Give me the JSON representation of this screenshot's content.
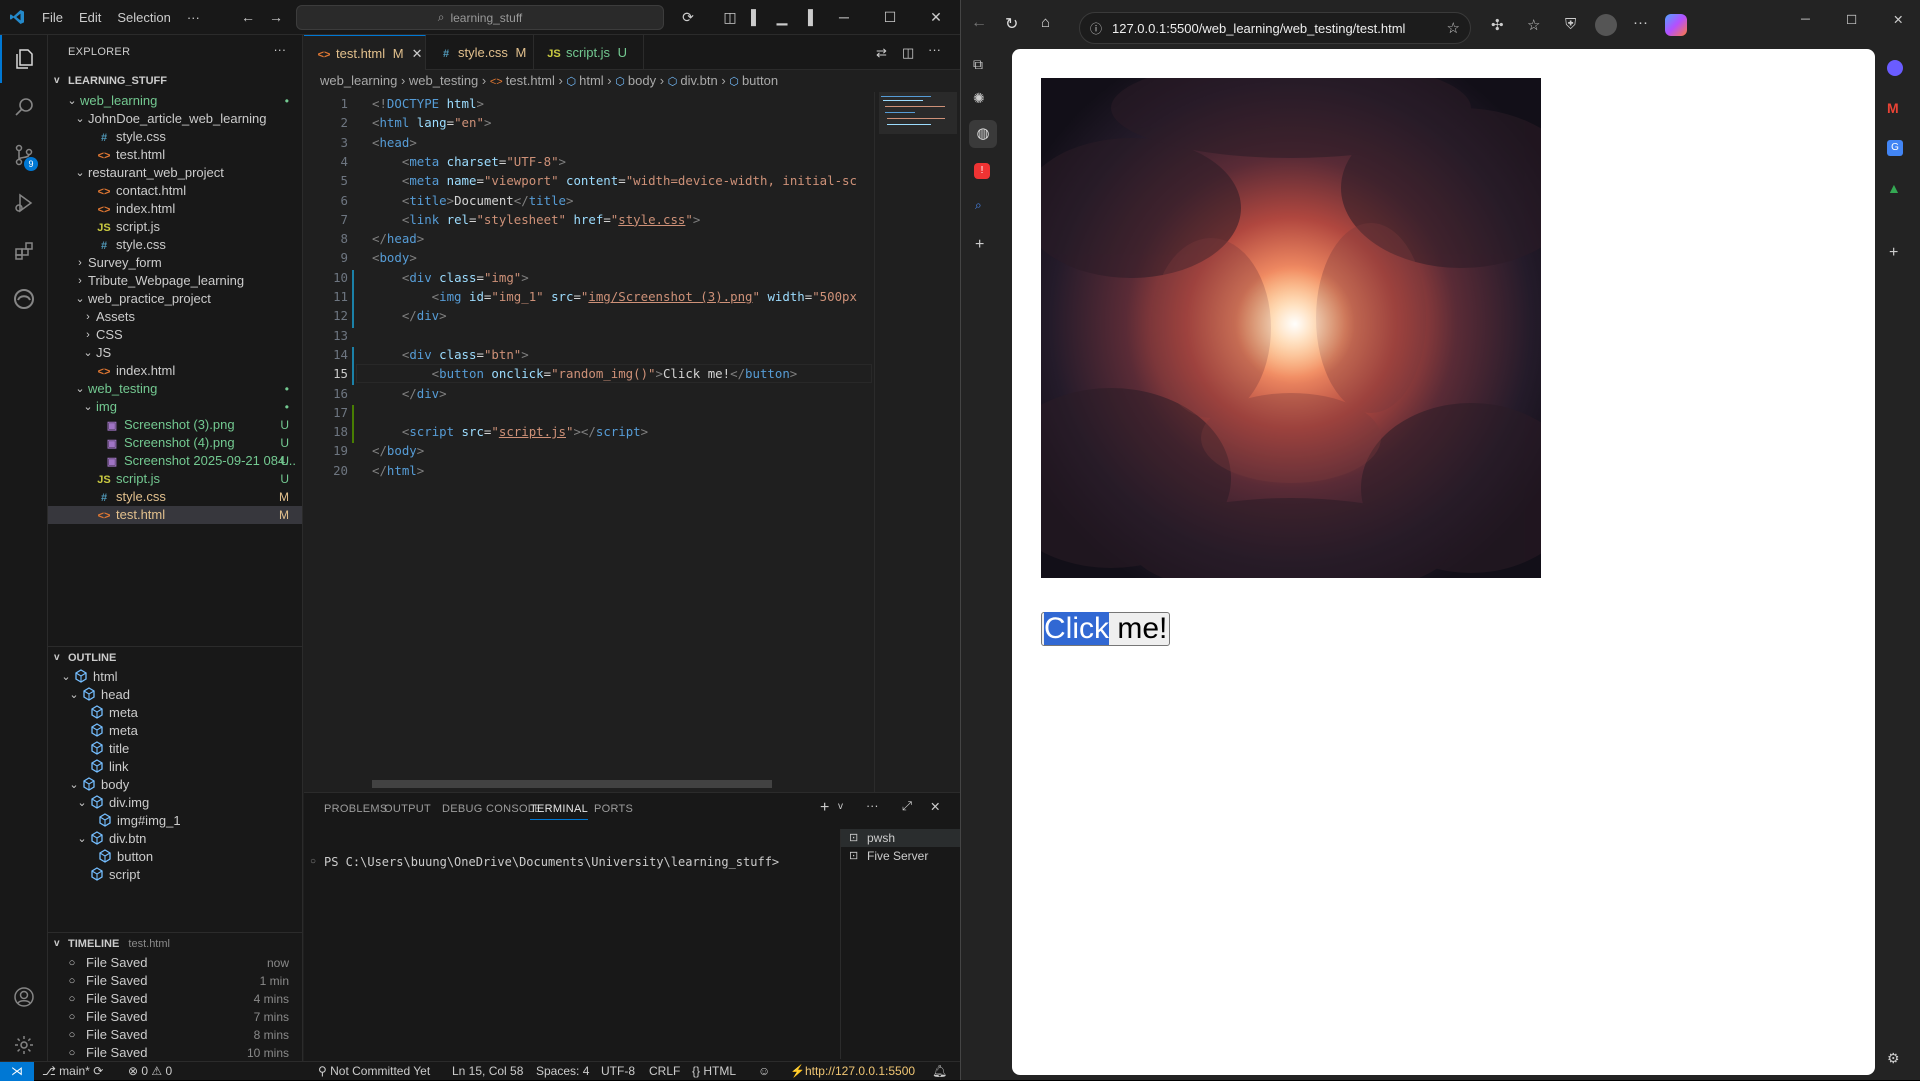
{
  "vscode": {
    "menu": [
      "File",
      "Edit",
      "Selection",
      "···"
    ],
    "search": "learning_stuff",
    "explorer": {
      "title": "EXPLORER",
      "root": "LEARNING_STUFF",
      "tree": [
        {
          "label": "web_learning",
          "indent": 1,
          "chev": "v",
          "color": "#73c991",
          "badge": "•",
          "badge_color": "#73c991"
        },
        {
          "label": "JohnDoe_article_web_learning",
          "indent": 2,
          "chev": "v",
          "color": "#cccccc"
        },
        {
          "label": "style.css",
          "indent": 3,
          "icon": "#",
          "icon_color": "#519aba",
          "color": "#cccccc"
        },
        {
          "label": "test.html",
          "indent": 3,
          "icon": "<>",
          "icon_color": "#e37933",
          "color": "#cccccc"
        },
        {
          "label": "restaurant_web_project",
          "indent": 2,
          "chev": "v",
          "color": "#cccccc"
        },
        {
          "label": "contact.html",
          "indent": 3,
          "icon": "<>",
          "icon_color": "#e37933",
          "color": "#cccccc"
        },
        {
          "label": "index.html",
          "indent": 3,
          "icon": "<>",
          "icon_color": "#e37933",
          "color": "#cccccc"
        },
        {
          "label": "script.js",
          "indent": 3,
          "icon": "JS",
          "icon_color": "#cbcb41",
          "color": "#cccccc"
        },
        {
          "label": "style.css",
          "indent": 3,
          "icon": "#",
          "icon_color": "#519aba",
          "color": "#cccccc"
        },
        {
          "label": "Survey_form",
          "indent": 2,
          "chev": ">",
          "color": "#cccccc"
        },
        {
          "label": "Tribute_Webpage_learning",
          "indent": 2,
          "chev": ">",
          "color": "#cccccc"
        },
        {
          "label": "web_practice_project",
          "indent": 2,
          "chev": "v",
          "color": "#cccccc"
        },
        {
          "label": "Assets",
          "indent": 3,
          "chev": ">",
          "color": "#cccccc"
        },
        {
          "label": "CSS",
          "indent": 3,
          "chev": ">",
          "color": "#cccccc"
        },
        {
          "label": "JS",
          "indent": 3,
          "chev": "v",
          "color": "#cccccc"
        },
        {
          "label": "index.html",
          "indent": 3,
          "icon": "<>",
          "icon_color": "#e37933",
          "color": "#cccccc"
        },
        {
          "label": "web_testing",
          "indent": 2,
          "chev": "v",
          "color": "#73c991",
          "badge": "•",
          "badge_color": "#73c991"
        },
        {
          "label": "img",
          "indent": 3,
          "chev": "v",
          "color": "#73c991",
          "badge": "•",
          "badge_color": "#73c991"
        },
        {
          "label": "Screenshot (3).png",
          "indent": 4,
          "icon": "▣",
          "icon_color": "#a074c4",
          "color": "#73c991",
          "badge": "U",
          "badge_color": "#73c991"
        },
        {
          "label": "Screenshot (4).png",
          "indent": 4,
          "icon": "▣",
          "icon_color": "#a074c4",
          "color": "#73c991",
          "badge": "U",
          "badge_color": "#73c991"
        },
        {
          "label": "Screenshot 2025-09-21 084...",
          "indent": 4,
          "icon": "▣",
          "icon_color": "#a074c4",
          "color": "#73c991",
          "badge": "U",
          "badge_color": "#73c991"
        },
        {
          "label": "script.js",
          "indent": 3,
          "icon": "JS",
          "icon_color": "#cbcb41",
          "color": "#73c991",
          "badge": "U",
          "badge_color": "#73c991"
        },
        {
          "label": "style.css",
          "indent": 3,
          "icon": "#",
          "icon_color": "#519aba",
          "color": "#e2c08d",
          "badge": "M",
          "badge_color": "#e2c08d"
        },
        {
          "label": "test.html",
          "indent": 3,
          "icon": "<>",
          "icon_color": "#e37933",
          "color": "#e2c08d",
          "badge": "M",
          "badge_color": "#e2c08d",
          "selected": true
        }
      ]
    },
    "outline": {
      "title": "OUTLINE",
      "items": [
        {
          "label": "html",
          "indent": 1,
          "chev": "v"
        },
        {
          "label": "head",
          "indent": 2,
          "chev": "v"
        },
        {
          "label": "meta",
          "indent": 3
        },
        {
          "label": "meta",
          "indent": 3
        },
        {
          "label": "title",
          "indent": 3
        },
        {
          "label": "link",
          "indent": 3
        },
        {
          "label": "body",
          "indent": 2,
          "chev": "v"
        },
        {
          "label": "div.img",
          "indent": 3,
          "chev": "v"
        },
        {
          "label": "img#img_1",
          "indent": 4
        },
        {
          "label": "div.btn",
          "indent": 3,
          "chev": "v"
        },
        {
          "label": "button",
          "indent": 4
        },
        {
          "label": "script",
          "indent": 3
        }
      ]
    },
    "timeline": {
      "title": "TIMELINE",
      "file": "test.html",
      "items": [
        {
          "label": "File Saved",
          "time": "now"
        },
        {
          "label": "File Saved",
          "time": "1 min"
        },
        {
          "label": "File Saved",
          "time": "4 mins"
        },
        {
          "label": "File Saved",
          "time": "7 mins"
        },
        {
          "label": "File Saved",
          "time": "8 mins"
        },
        {
          "label": "File Saved",
          "time": "10 mins"
        }
      ]
    },
    "tabs": [
      {
        "label": "test.html",
        "status": "M",
        "icon": "<>",
        "icon_color": "#e37933",
        "active": true,
        "close": "✕"
      },
      {
        "label": "style.css",
        "status": "M",
        "icon": "#",
        "icon_color": "#519aba"
      },
      {
        "label": "script.js",
        "status": "U",
        "icon": "JS",
        "icon_color": "#cbcb41"
      }
    ],
    "breadcrumb": [
      "web_learning",
      "web_testing",
      "test.html",
      "html",
      "body",
      "div.btn",
      "button"
    ],
    "code_lines": [
      [
        [
          "<!",
          "p"
        ],
        [
          "DOCTYPE",
          "t"
        ],
        [
          " html",
          "a"
        ],
        [
          ">",
          "p"
        ]
      ],
      [
        [
          "<",
          "p"
        ],
        [
          "html",
          "t"
        ],
        [
          " lang",
          "a"
        ],
        [
          "=",
          "w"
        ],
        [
          "\"en\"",
          "s"
        ],
        [
          ">",
          "p"
        ]
      ],
      [
        [
          "<",
          "p"
        ],
        [
          "head",
          "t"
        ],
        [
          ">",
          "p"
        ]
      ],
      [
        [
          "    <",
          "p"
        ],
        [
          "meta",
          "t"
        ],
        [
          " charset",
          "a"
        ],
        [
          "=",
          "w"
        ],
        [
          "\"UTF-8\"",
          "s"
        ],
        [
          ">",
          "p"
        ]
      ],
      [
        [
          "    <",
          "p"
        ],
        [
          "meta",
          "t"
        ],
        [
          " name",
          "a"
        ],
        [
          "=",
          "w"
        ],
        [
          "\"viewport\"",
          "s"
        ],
        [
          " content",
          "a"
        ],
        [
          "=",
          "w"
        ],
        [
          "\"width=device-width, initial-sc",
          "s"
        ]
      ],
      [
        [
          "    <",
          "p"
        ],
        [
          "title",
          "t"
        ],
        [
          ">",
          "p"
        ],
        [
          "Document",
          "w"
        ],
        [
          "</",
          "p"
        ],
        [
          "title",
          "t"
        ],
        [
          ">",
          "p"
        ]
      ],
      [
        [
          "    <",
          "p"
        ],
        [
          "link",
          "t"
        ],
        [
          " rel",
          "a"
        ],
        [
          "=",
          "w"
        ],
        [
          "\"stylesheet\"",
          "s"
        ],
        [
          " href",
          "a"
        ],
        [
          "=",
          "w"
        ],
        [
          "\"",
          "s"
        ],
        [
          "style.css",
          "su"
        ],
        [
          "\"",
          "s"
        ],
        [
          ">",
          "p"
        ]
      ],
      [
        [
          "</",
          "p"
        ],
        [
          "head",
          "t"
        ],
        [
          ">",
          "p"
        ]
      ],
      [
        [
          "<",
          "p"
        ],
        [
          "body",
          "t"
        ],
        [
          ">",
          "p"
        ]
      ],
      [
        [
          "    <",
          "p"
        ],
        [
          "div",
          "t"
        ],
        [
          " class",
          "a"
        ],
        [
          "=",
          "w"
        ],
        [
          "\"img\"",
          "s"
        ],
        [
          ">",
          "p"
        ]
      ],
      [
        [
          "        <",
          "p"
        ],
        [
          "img",
          "t"
        ],
        [
          " id",
          "a"
        ],
        [
          "=",
          "w"
        ],
        [
          "\"img_1\"",
          "s"
        ],
        [
          " src",
          "a"
        ],
        [
          "=",
          "w"
        ],
        [
          "\"",
          "s"
        ],
        [
          "img/Screenshot (3).png",
          "su"
        ],
        [
          "\"",
          "s"
        ],
        [
          " width",
          "a"
        ],
        [
          "=",
          "w"
        ],
        [
          "\"500px",
          "s"
        ]
      ],
      [
        [
          "    </",
          "p"
        ],
        [
          "div",
          "t"
        ],
        [
          ">",
          "p"
        ]
      ],
      [
        [
          "",
          "w"
        ]
      ],
      [
        [
          "    <",
          "p"
        ],
        [
          "div",
          "t"
        ],
        [
          " class",
          "a"
        ],
        [
          "=",
          "w"
        ],
        [
          "\"btn\"",
          "s"
        ],
        [
          ">",
          "p"
        ]
      ],
      [
        [
          "        <",
          "p"
        ],
        [
          "button",
          "t"
        ],
        [
          " onclick",
          "a"
        ],
        [
          "=",
          "w"
        ],
        [
          "\"random_img()\"",
          "s"
        ],
        [
          ">",
          "p"
        ],
        [
          "Click me!",
          "w"
        ],
        [
          "</",
          "p"
        ],
        [
          "button",
          "t"
        ],
        [
          ">",
          "p"
        ]
      ],
      [
        [
          "    </",
          "p"
        ],
        [
          "div",
          "t"
        ],
        [
          ">",
          "p"
        ]
      ],
      [
        [
          "",
          "w"
        ]
      ],
      [
        [
          "    <",
          "p"
        ],
        [
          "script",
          "t"
        ],
        [
          " src",
          "a"
        ],
        [
          "=",
          "w"
        ],
        [
          "\"",
          "s"
        ],
        [
          "script.js",
          "su"
        ],
        [
          "\"",
          "s"
        ],
        [
          "></",
          "p"
        ],
        [
          "script",
          "t"
        ],
        [
          ">",
          "p"
        ]
      ],
      [
        [
          "</",
          "p"
        ],
        [
          "body",
          "t"
        ],
        [
          ">",
          "p"
        ]
      ],
      [
        [
          "</",
          "p"
        ],
        [
          "html",
          "t"
        ],
        [
          ">",
          "p"
        ]
      ]
    ],
    "active_line": 15,
    "panel_tabs": [
      "PROBLEMS",
      "OUTPUT",
      "DEBUG CONSOLE",
      "TERMINAL",
      "PORTS"
    ],
    "panel_active": "TERMINAL",
    "terminal_prompt": "PS C:\\Users\\buung\\OneDrive\\Documents\\University\\learning_stuff>",
    "terminals": [
      "pwsh",
      "Five Server"
    ],
    "status": {
      "branch": "main*",
      "errors": "0",
      "warnings": "0",
      "commit": "Not Committed Yet",
      "cursor": "Ln 15, Col 58",
      "spaces": "Spaces: 4",
      "encoding": "UTF-8",
      "eol": "CRLF",
      "language": "HTML",
      "server": "http://127.0.0.1:5500"
    }
  },
  "browser": {
    "url": "127.0.0.1:5500/web_learning/web_testing/test.html",
    "button_text_selected": "Click",
    "button_text_rest": " me!"
  },
  "colors": {
    "accent": "#0078d4",
    "added": "#73c991",
    "modified": "#e2c08d",
    "selection": "#3168d3"
  }
}
